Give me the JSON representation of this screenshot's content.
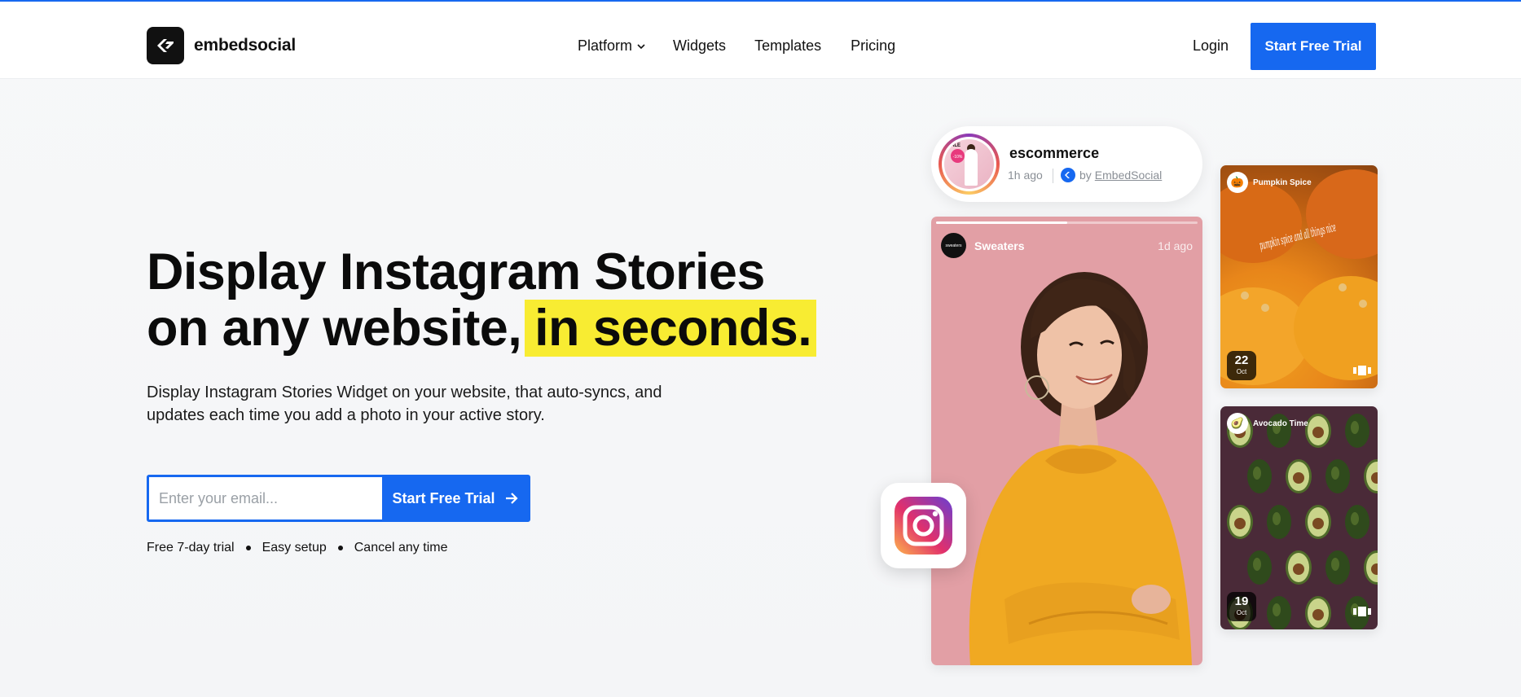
{
  "brand": {
    "name": "embedsocial",
    "accent": "#1668f0",
    "highlight": "#f8ec32"
  },
  "nav": {
    "items": [
      {
        "label": "Platform",
        "has_dropdown": true
      },
      {
        "label": "Widgets"
      },
      {
        "label": "Templates"
      },
      {
        "label": "Pricing"
      }
    ],
    "login": "Login",
    "cta": "Start Free Trial"
  },
  "hero": {
    "title_line1": "Display Instagram Stories",
    "title_line2_plain": "on any website,",
    "title_line2_highlight": "in seconds.",
    "subtitle": "Display Instagram Stories Widget on your website, that auto-syncs, and updates each time you add a photo in your active story.",
    "email_placeholder": "Enter your email...",
    "cta": "Start Free Trial",
    "perks": [
      "Free 7-day trial",
      "Easy setup",
      "Cancel any time"
    ]
  },
  "profile_card": {
    "name": "escommerce",
    "time": "1h ago",
    "by_prefix": "by",
    "by_link": "EmbedSocial",
    "avatar_badge": "-10%",
    "avatar_tag": "SALE"
  },
  "main_story": {
    "user": "Sweaters",
    "time": "1d ago",
    "avatar_text": "sweaters",
    "progress": 0.5
  },
  "story_cards": [
    {
      "title": "Pumpkin Spice",
      "day": "22",
      "month": "Oct",
      "overlay_text": "pumpkin spice and all things nice",
      "icon": "pumpkin-icon"
    },
    {
      "title": "Avocado Time",
      "day": "19",
      "month": "Oct",
      "icon": "avocado-icon"
    }
  ]
}
